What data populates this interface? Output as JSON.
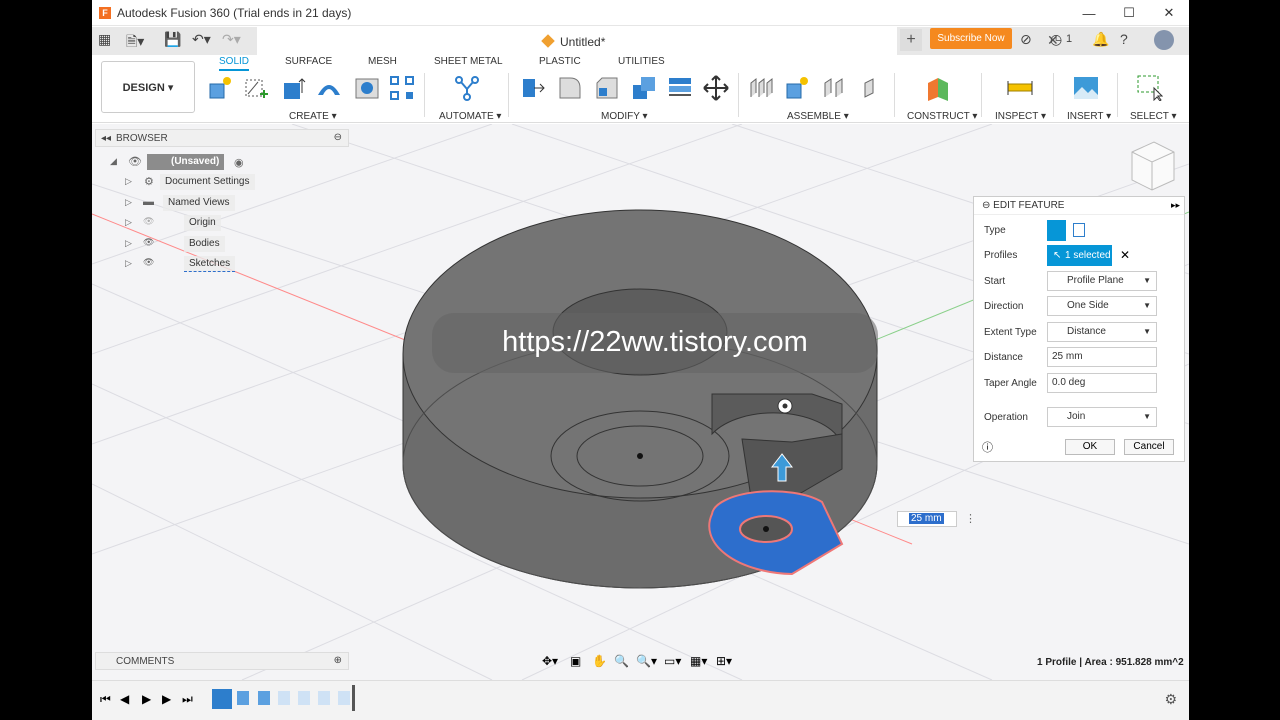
{
  "window": {
    "title": "Autodesk Fusion 360 (Trial ends in 21 days)",
    "app_icon": "F"
  },
  "tabs": {
    "doc_label": "Untitled*",
    "subscribe": "Subscribe Now",
    "jobs": "1"
  },
  "toolbar": {
    "design": "DESIGN ▾",
    "tabs": [
      "SOLID",
      "SURFACE",
      "MESH",
      "SHEET METAL",
      "PLASTIC",
      "UTILITIES"
    ],
    "groups": {
      "create": "CREATE ▾",
      "automate": "AUTOMATE ▾",
      "modify": "MODIFY ▾",
      "assemble": "ASSEMBLE ▾",
      "construct": "CONSTRUCT ▾",
      "inspect": "INSPECT ▾",
      "insert": "INSERT ▾",
      "select": "SELECT ▾"
    }
  },
  "browser": {
    "title": "BROWSER",
    "root": "(Unsaved)",
    "items": [
      "Document Settings",
      "Named Views",
      "Origin",
      "Bodies",
      "Sketches"
    ]
  },
  "edit_feature": {
    "title": "EDIT FEATURE",
    "type_label": "Type",
    "profiles_label": "Profiles",
    "profiles_value": "1 selected",
    "start_label": "Start",
    "start_value": "Profile Plane",
    "direction_label": "Direction",
    "direction_value": "One Side",
    "extent_label": "Extent Type",
    "extent_value": "Distance",
    "distance_label": "Distance",
    "distance_value": "25 mm",
    "taper_label": "Taper Angle",
    "taper_value": "0.0 deg",
    "operation_label": "Operation",
    "operation_value": "Join",
    "ok": "OK",
    "cancel": "Cancel"
  },
  "viewport": {
    "watermark": "https://22ww.tistory.com",
    "dimension_value": "25 mm",
    "area_readout": "1 Profile | Area : 951.828 mm^2"
  },
  "comments": {
    "title": "COMMENTS"
  },
  "colors": {
    "accent": "#0696d7",
    "subscribe": "#f5891f",
    "profile_fill": "#2d6ecc",
    "body": "#6b6b6b"
  }
}
